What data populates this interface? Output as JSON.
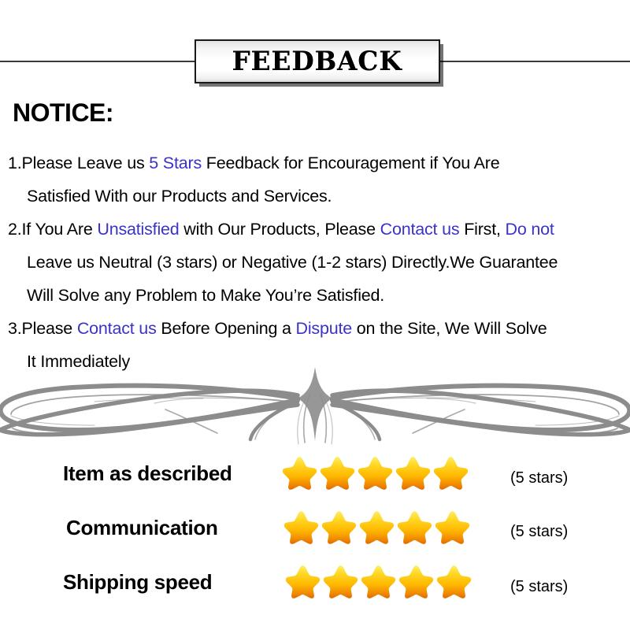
{
  "banner": {
    "title": "FEEDBACK"
  },
  "notice": {
    "heading": "NOTICE:",
    "items": [
      {
        "lines": [
          [
            {
              "text": "1.Please Leave us  ",
              "color": "black"
            },
            {
              "text": "5 Stars",
              "color": "blue"
            },
            {
              "text": "  Feedback for  Encouragement  if You Are",
              "color": "black"
            }
          ],
          [
            {
              "text": "Satisfied With our Products and Services.",
              "color": "black"
            }
          ]
        ]
      },
      {
        "lines": [
          [
            {
              "text": "2.If You Are ",
              "color": "black"
            },
            {
              "text": "Unsatisfied",
              "color": "blue"
            },
            {
              "text": " with Our Products, Please ",
              "color": "black"
            },
            {
              "text": "Contact us",
              "color": "blue"
            },
            {
              "text": " First, ",
              "color": "black"
            },
            {
              "text": "Do not",
              "color": "blue"
            }
          ],
          [
            {
              "text": "Leave us Neutral (3 stars) or Negative (1-2 stars) Directly.We Guarantee",
              "color": "black"
            }
          ],
          [
            {
              "text": "Will Solve any Problem to Make You’re  Satisfied.",
              "color": "black"
            }
          ]
        ]
      },
      {
        "lines": [
          [
            {
              "text": "3.Please ",
              "color": "black"
            },
            {
              "text": "Contact us",
              "color": "blue"
            },
            {
              "text": " Before Opening a ",
              "color": "black"
            },
            {
              "text": "Dispute",
              "color": "blue"
            },
            {
              "text": " on the Site, We Will Solve",
              "color": "black"
            }
          ],
          [
            {
              "text": "It Immediately",
              "color": "black"
            }
          ]
        ]
      }
    ]
  },
  "ornament": {
    "name": "decorative-flourish-divider",
    "color": "#8c8c8c"
  },
  "ratings": {
    "rows": [
      {
        "label": "Item as described",
        "stars": 5,
        "count_text": "(5 stars)"
      },
      {
        "label": "Communication",
        "stars": 5,
        "count_text": "(5 stars)"
      },
      {
        "label": "Shipping speed",
        "stars": 5,
        "count_text": "(5 stars)"
      }
    ]
  },
  "colors": {
    "link_blue": "#3B33C8",
    "star_top": "#FFE14D",
    "star_mid": "#FFC20A",
    "star_bottom": "#EE8800",
    "ornament_gray": "#8c8c8c"
  }
}
